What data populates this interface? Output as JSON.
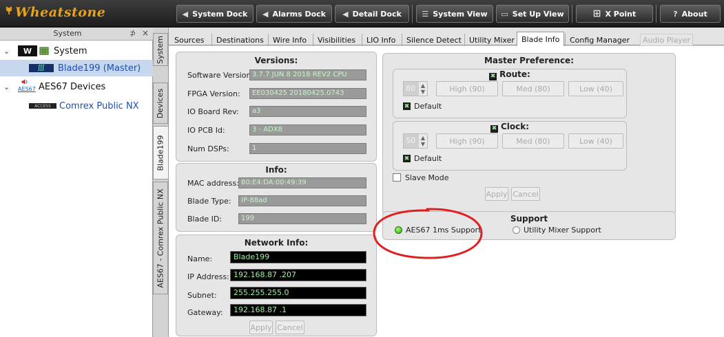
{
  "app": {
    "logo": "Wheatstone",
    "toolbar": [
      {
        "icon": "◀",
        "label": "System Dock"
      },
      {
        "icon": "◀",
        "label": "Alarms Dock"
      },
      {
        "icon": "◀",
        "label": "Detail Dock"
      },
      {
        "icon": "☰",
        "label": "System View"
      },
      {
        "icon": "▭",
        "label": "Set Up View"
      },
      {
        "icon": "⊞",
        "label": "X Point"
      },
      {
        "icon": "?",
        "label": "About"
      }
    ]
  },
  "sidebar": {
    "title": "System",
    "pin": "⊅",
    "close": "×",
    "tree": [
      {
        "label": "System",
        "icon_text": "W"
      },
      {
        "label": "Blade199 (Master)",
        "icon_text": "ʃʃʃ"
      },
      {
        "label": "AES67 Devices",
        "icon_text": "AES67"
      },
      {
        "label": "Comrex Public NX",
        "icon_text": "ACCESS"
      }
    ]
  },
  "vertical_tabs": [
    "System",
    "Devices",
    "Blade199",
    "AES67 - Comrex Public NX"
  ],
  "tabs": [
    "Sources",
    "Destinations",
    "Wire Info",
    "Visibilities",
    "LIO Info",
    "Silence Detect",
    "Utility Mixer",
    "Blade Info",
    "Config Manager",
    "Audio Player"
  ],
  "versions": {
    "title": "Versions:",
    "software_label": "Software Version:",
    "software": "3.7.7  JUN  8 2018 REV2 CPU",
    "fpga_label": "FPGA Version:",
    "fpga": "EE030425 20180425.0743",
    "ioboard_label": "IO Board Rev:",
    "ioboard": "a3",
    "iopcb_label": "IO PCB Id:",
    "iopcb": "3 - ADX8",
    "dsps_label": "Num DSPs:",
    "dsps": "1"
  },
  "info": {
    "title": "Info:",
    "mac_label": "MAC address:",
    "mac": "80:E4:DA:00:49:39",
    "type_label": "Blade Type:",
    "type": "IP-88ad",
    "id_label": "Blade ID:",
    "id": "199"
  },
  "network": {
    "title": "Network Info:",
    "name_label": "Name:",
    "name": "Blade199",
    "ip_label": "IP Address:",
    "ip": "192.168.87 .207",
    "subnet_label": "Subnet:",
    "subnet": "255.255.255.0",
    "gateway_label": "Gateway:",
    "gateway": "192.168.87 .1",
    "apply": "Apply",
    "cancel": "Cancel"
  },
  "master": {
    "title": "Master Preference:",
    "route": {
      "title": "Route:",
      "value": "80",
      "high": "High (90)",
      "med": "Med (80)",
      "low": "Low (40)",
      "default": "Default"
    },
    "clock": {
      "title": "Clock:",
      "value": "50",
      "high": "High (90)",
      "med": "Med (80)",
      "low": "Low (40)",
      "default": "Default"
    },
    "slave": "Slave Mode",
    "apply": "Apply",
    "cancel": "Cancel"
  },
  "support": {
    "title": "Support",
    "aes67": "AES67 1ms Support",
    "utility": "Utility Mixer Support"
  },
  "checkmark": "✖",
  "spin_up": "▲",
  "spin_down": "▼",
  "annotation_color": "#e02020"
}
